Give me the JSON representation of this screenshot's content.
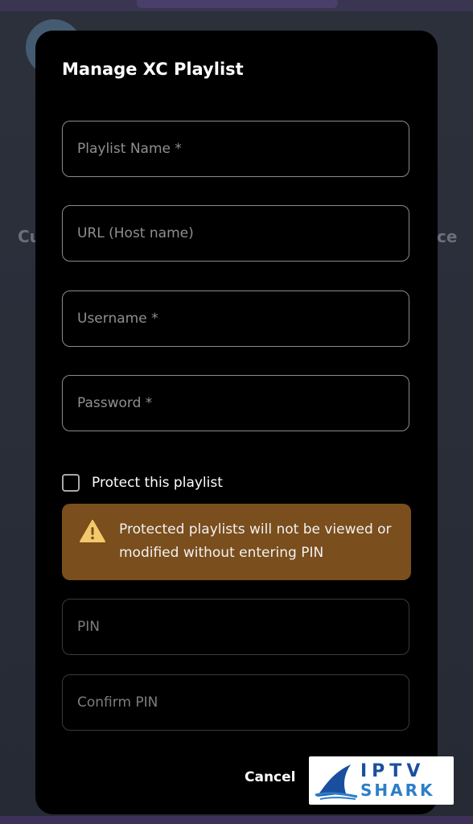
{
  "background": {
    "left_partial_text": "Cu",
    "right_partial_text": "ce"
  },
  "dialog": {
    "title": "Manage XC Playlist",
    "fields": {
      "playlist_name": {
        "placeholder": "Playlist Name *",
        "value": ""
      },
      "url": {
        "placeholder": "URL (Host name)",
        "value": ""
      },
      "username": {
        "placeholder": "Username *",
        "value": ""
      },
      "password": {
        "placeholder": "Password *",
        "value": ""
      },
      "pin": {
        "placeholder": "PIN",
        "value": ""
      },
      "confirm_pin": {
        "placeholder": "Confirm PIN",
        "value": ""
      }
    },
    "protect_checkbox": {
      "label": "Protect this playlist",
      "checked": false
    },
    "warning": {
      "icon": "warning-triangle-icon",
      "text": "Protected playlists will not be viewed or modified without entering PIN"
    },
    "cancel_label": "Cancel"
  },
  "watermark": {
    "line1": "IPTV",
    "line2": "SHARK"
  },
  "colors": {
    "dialog_bg": "#000000",
    "warning_bg": "#7a4e1d",
    "warning_icon": "#f3c96b",
    "field_border": "#8b8b8b",
    "logo_blue": "#1a4f9f"
  }
}
